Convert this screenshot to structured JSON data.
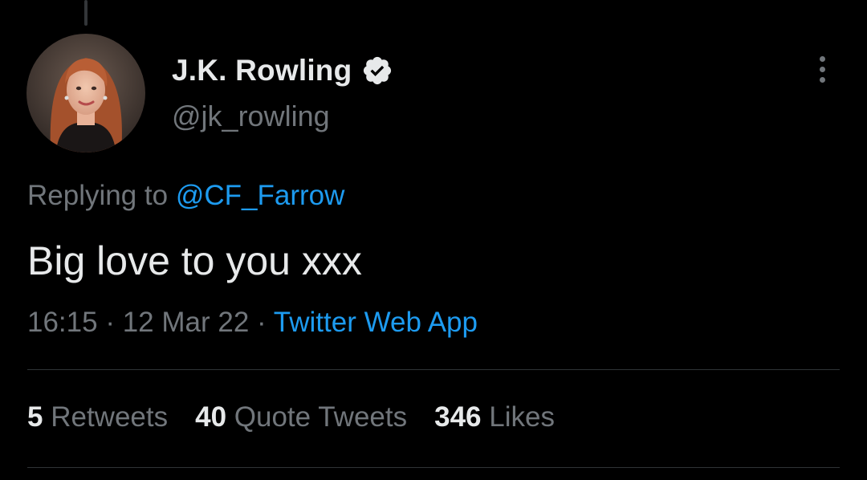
{
  "author": {
    "display_name": "J.K. Rowling",
    "handle": "@jk_rowling",
    "verified": true,
    "avatar_icon": "profile-photo"
  },
  "reply": {
    "prefix": "Replying to",
    "mention": "@CF_Farrow"
  },
  "tweet": {
    "text": "Big love to you xxx",
    "time": "16:15",
    "date": "12 Mar 22",
    "separator": "·",
    "source": "Twitter Web App"
  },
  "stats": {
    "retweets": {
      "count": "5",
      "label": "Retweets"
    },
    "quote_tweets": {
      "count": "40",
      "label": "Quote Tweets"
    },
    "likes": {
      "count": "346",
      "label": "Likes"
    }
  },
  "colors": {
    "background": "#000000",
    "primary_text": "#e7e9ea",
    "secondary_text": "#71767b",
    "accent": "#1d9bf0",
    "divider": "#2f3336"
  },
  "icons": {
    "verified": "verified-badge-icon",
    "more": "more-options-icon"
  }
}
